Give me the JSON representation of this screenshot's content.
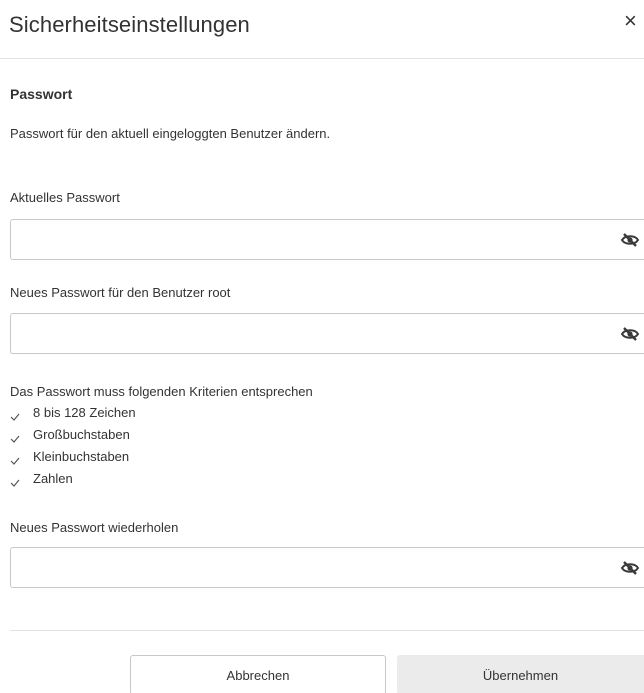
{
  "dialog": {
    "title": "Sicherheitseinstellungen",
    "close_label": "×"
  },
  "password": {
    "section_title": "Passwort",
    "description": "Passwort für den aktuell eingeloggten Benutzer ändern.",
    "current_label": "Aktuelles Passwort",
    "current_value": "",
    "new_label": "Neues Passwort für den Benutzer root",
    "new_value": "",
    "repeat_label": "Neues Passwort wiederholen",
    "repeat_value": "",
    "visibility_icon": "eye-slash-icon"
  },
  "criteria": {
    "title": "Das Passwort muss folgenden Kriterien entsprechen",
    "items": [
      "8 bis 128 Zeichen",
      "Großbuchstaben",
      "Kleinbuchstaben",
      "Zahlen"
    ],
    "icon": "check-icon"
  },
  "buttons": {
    "cancel_label": "Abbrechen",
    "apply_label": "Übernehmen"
  },
  "colors": {
    "border": "#c8c8c8",
    "divider": "#e3e3e3",
    "apply_bg": "#ebebeb",
    "text": "#333333"
  }
}
